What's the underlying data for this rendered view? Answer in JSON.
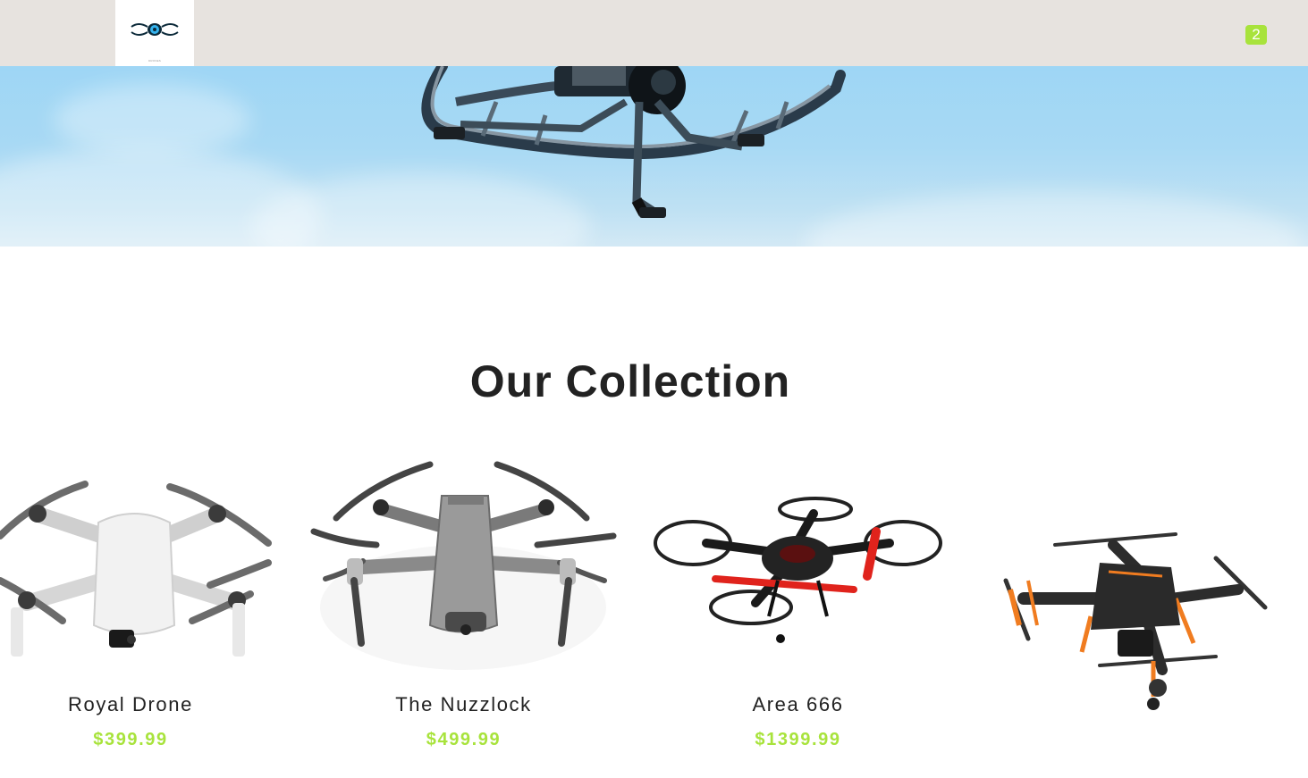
{
  "header": {
    "logo_alt": "drone-logo",
    "logo_tagline": "DRONES",
    "cart_count": "2"
  },
  "collection": {
    "title": "Our Collection",
    "products": [
      {
        "name": "Royal Drone",
        "price": "$399.99"
      },
      {
        "name": "The Nuzzlock",
        "price": "$499.99"
      },
      {
        "name": "Area 666",
        "price": "$1399.99"
      },
      {
        "name": "",
        "price": ""
      }
    ]
  },
  "colors": {
    "header_bg": "#e7e3df",
    "accent": "#a8e33c",
    "text": "#222222",
    "sky": "#a8d9f4"
  }
}
